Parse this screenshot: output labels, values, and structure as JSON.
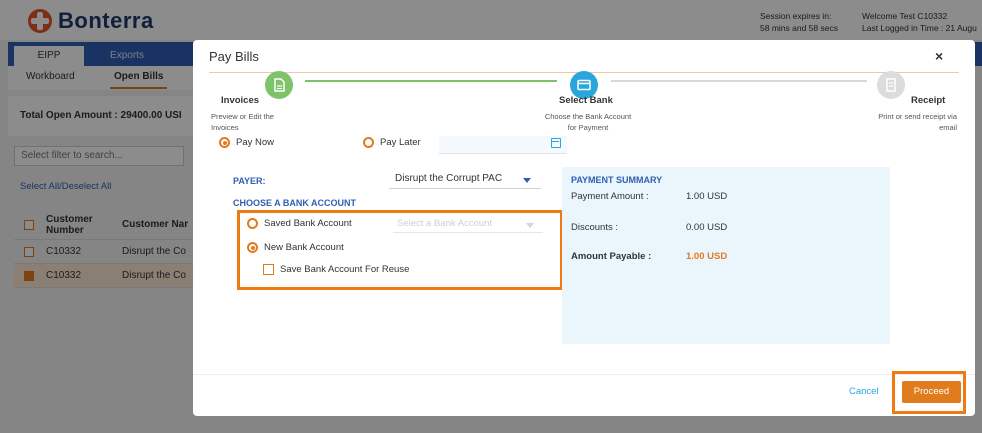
{
  "app": {
    "brand": "Bonterra",
    "session_label": "Session expires in:",
    "session_time": "58 mins and 58 secs",
    "welcome": "Welcome Test C10332",
    "last_logged": "Last Logged in Time : 21 Augu",
    "tabs": [
      "EIPP",
      "Exports"
    ],
    "subtabs": [
      "Workboard",
      "Open Bills"
    ],
    "total_label": "Total Open Amount : 29400.00  USI",
    "filter_placeholder": "Select filter to search...",
    "select_all": "Select All/Deselect All",
    "grid": {
      "headers": [
        "Customer Number",
        "Customer Nar"
      ],
      "rows": [
        {
          "number": "C10332",
          "name": "Disrupt the Co",
          "checked": false
        },
        {
          "number": "C10332",
          "name": "Disrupt the Co",
          "checked": true
        }
      ]
    }
  },
  "modal": {
    "title": "Pay Bills",
    "close_glyph": "×",
    "steps": [
      {
        "label": "Invoices",
        "desc": "Preview or Edit the Invoices",
        "icon": "document-icon"
      },
      {
        "label": "Select Bank",
        "desc": "Choose the Bank Account for Payment",
        "icon": "card-icon"
      },
      {
        "label": "Receipt",
        "desc": "Print or send receipt via email",
        "icon": "receipt-icon"
      }
    ],
    "pay_now": "Pay Now",
    "pay_later": "Pay Later",
    "payer_label": "PAYER:",
    "payer_value": "Disrupt the Corrupt PAC",
    "choose_label": "CHOOSE A BANK ACCOUNT",
    "saved_account": "Saved Bank Account",
    "bank_placeholder": "Select a Bank Account",
    "new_account": "New Bank Account",
    "save_reuse": "Save Bank Account For Reuse",
    "summary": {
      "title": "PAYMENT SUMMARY",
      "payment_amount_label": "Payment Amount :",
      "payment_amount": "1.00 USD",
      "discounts_label": "Discounts :",
      "discounts": "0.00 USD",
      "payable_label": "Amount Payable :",
      "payable": "1.00 USD"
    },
    "cancel": "Cancel",
    "proceed": "Proceed"
  },
  "colors": {
    "accent": "#e07b1e",
    "primary": "#2f5fb2",
    "step_done": "#7cc36a",
    "step_active": "#29a6dc",
    "highlight": "#f07a12"
  }
}
